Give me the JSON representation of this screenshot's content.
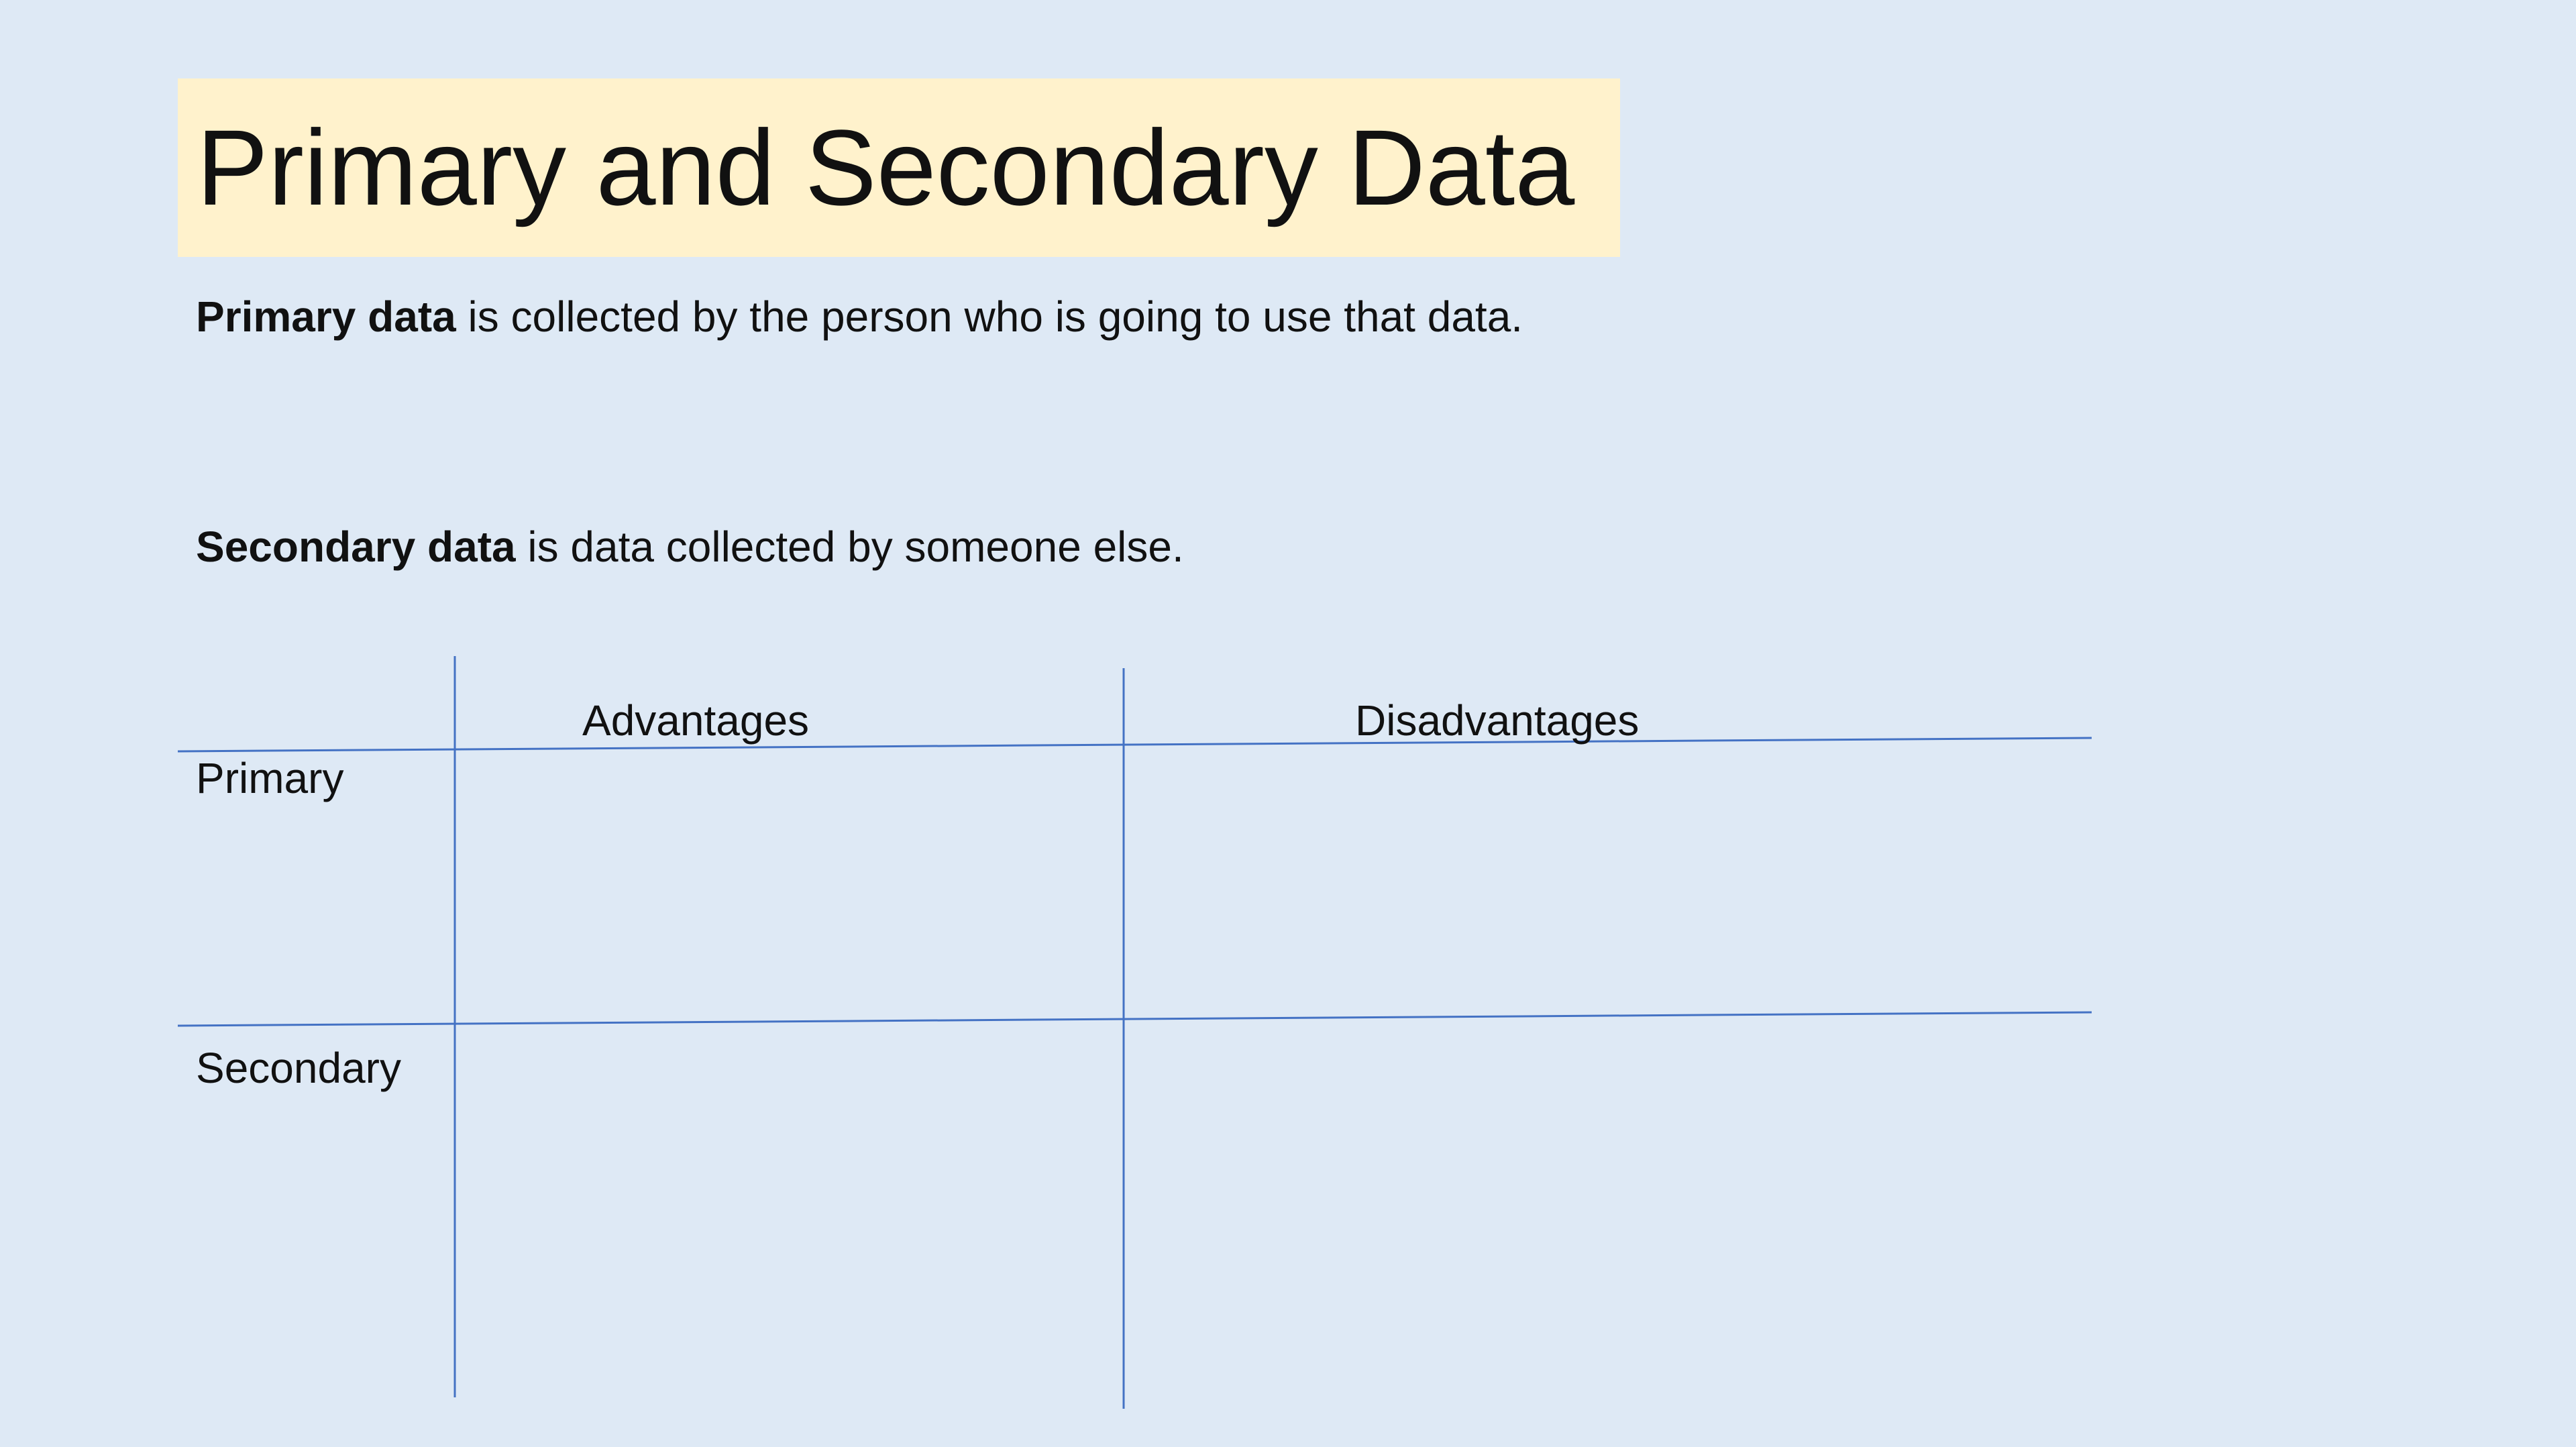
{
  "slide": {
    "title": "Primary and Secondary Data",
    "primary_definition": {
      "term": "Primary data",
      "text": " is collected by the person who is going to use that data."
    },
    "secondary_definition": {
      "term": "Secondary data",
      "text": " is data collected by someone else."
    },
    "table": {
      "column_headers": [
        "Advantages",
        "Disadvantages"
      ],
      "row_headers": [
        "Primary",
        "Secondary"
      ],
      "line_color": "#4472c4"
    },
    "colors": {
      "background": "#dee9f5",
      "title_highlight": "#fff2cc"
    }
  }
}
